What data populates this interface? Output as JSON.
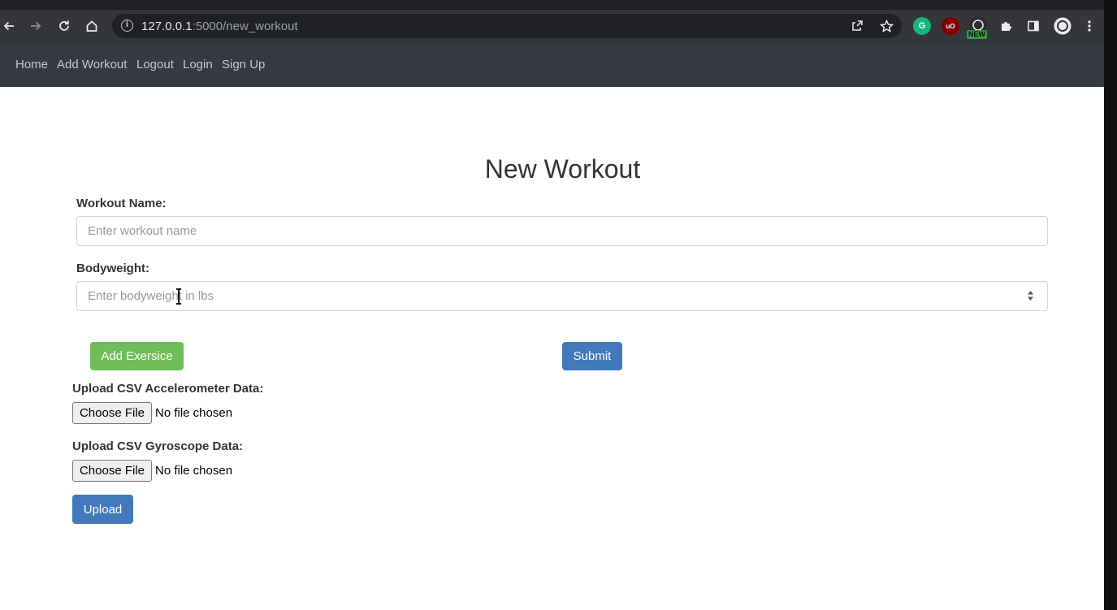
{
  "browser": {
    "url_host": "127.0.0.1",
    "url_path": ":5000/new_workout",
    "extension_badge": "NEW"
  },
  "navbar": {
    "links": [
      "Home",
      "Add Workout",
      "Logout",
      "Login",
      "Sign Up"
    ]
  },
  "form": {
    "title": "New Workout",
    "workout_name_label": "Workout Name:",
    "workout_name_placeholder": "Enter workout name",
    "bodyweight_label": "Bodyweight:",
    "bodyweight_placeholder": "Enter bodyweight in lbs",
    "add_exercise_label": "Add Exersice",
    "submit_label": "Submit"
  },
  "upload": {
    "accelerometer_label": "Upload CSV Accelerometer Data:",
    "gyroscope_label": "Upload CSV Gyroscope Data:",
    "choose_file_label": "Choose File",
    "no_file_text": "No file chosen",
    "upload_label": "Upload"
  },
  "colors": {
    "navbar_bg": "#353a40",
    "green_button": "#6fbd5a",
    "blue_button": "#4279bc"
  }
}
